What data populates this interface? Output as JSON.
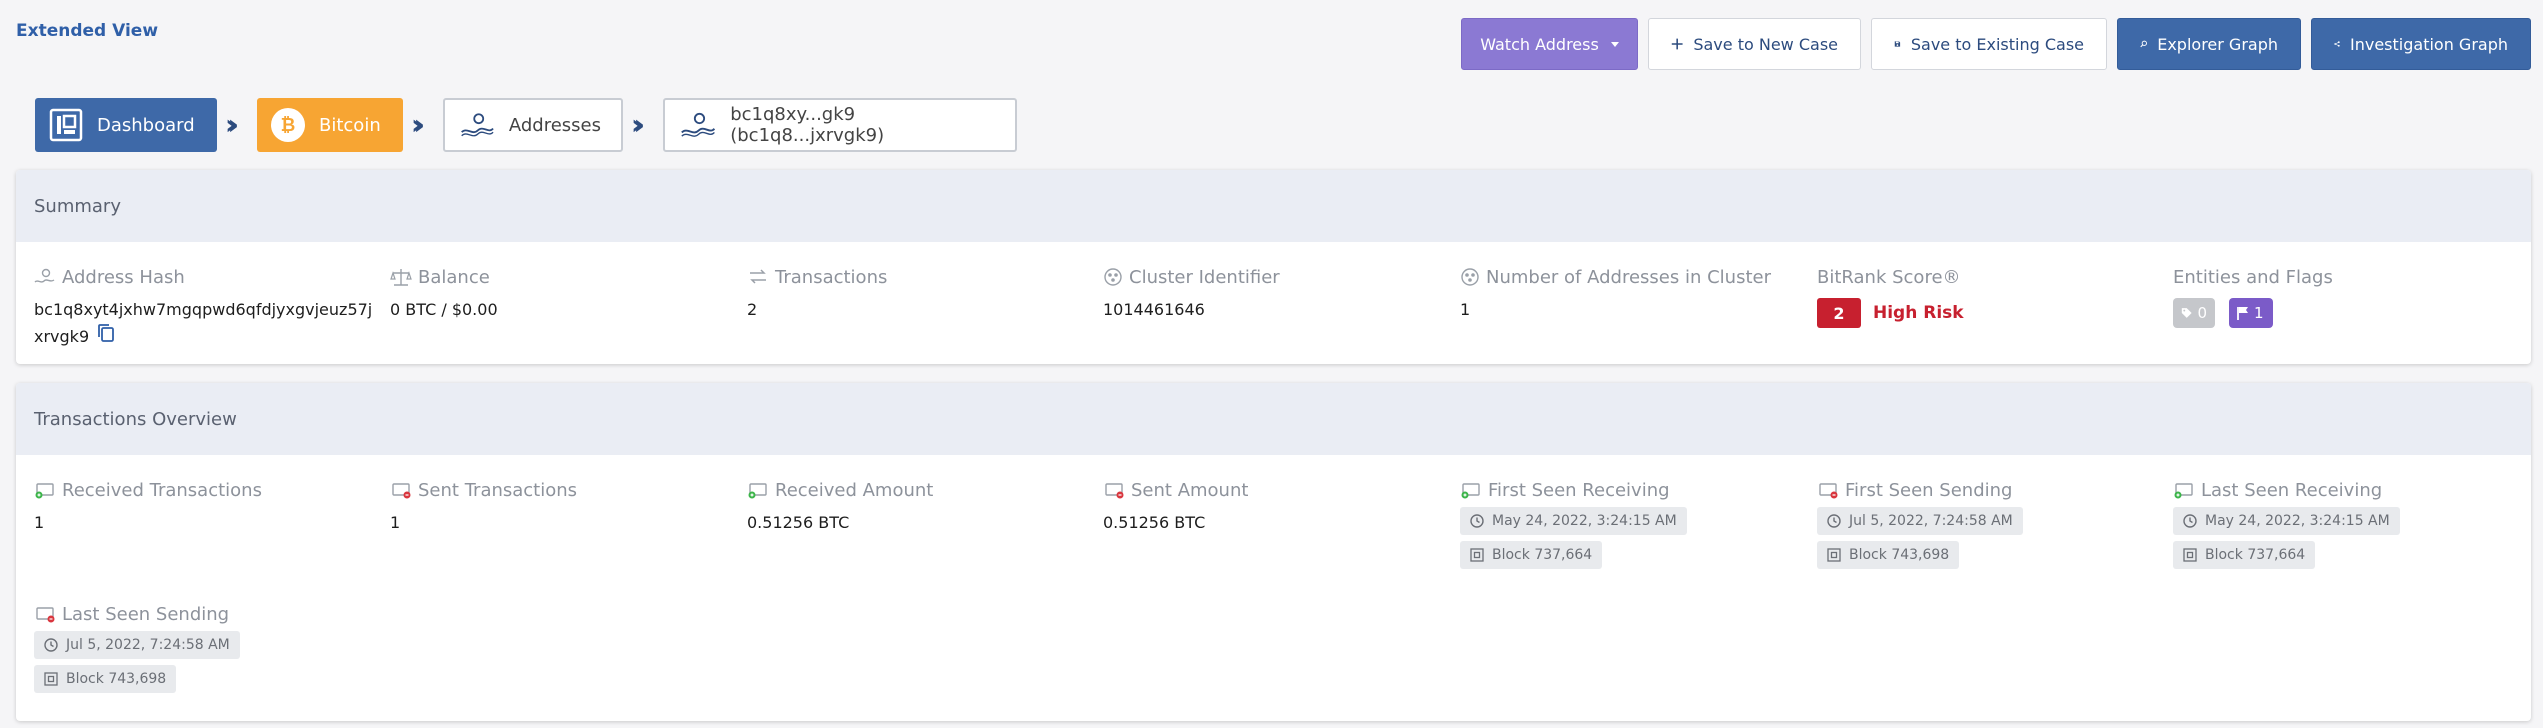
{
  "header": {
    "extended_view": "Extended View",
    "buttons": {
      "watch": "Watch Address",
      "save_new": "Save to New Case",
      "save_existing": "Save to Existing Case",
      "explorer": "Explorer Graph",
      "investigation": "Investigation Graph"
    }
  },
  "breadcrumb": {
    "dashboard": "Dashboard",
    "bitcoin": "Bitcoin",
    "addresses": "Addresses",
    "address": "bc1q8xy...gk9 (bc1q8...jxrvgk9)"
  },
  "summary": {
    "title": "Summary",
    "address_hash_label": "Address Hash",
    "address_hash_line1": "bc1q8xyt4jxhw7mgqpwd6qfdjyxgvjeuz57j",
    "address_hash_line2": "xrvgk9",
    "balance_label": "Balance",
    "balance_value": "0 BTC / $0.00",
    "transactions_label": "Transactions",
    "transactions_value": "2",
    "cluster_label": "Cluster Identifier",
    "cluster_value": "1014461646",
    "num_addresses_label": "Number of Addresses in Cluster",
    "num_addresses_value": "1",
    "bitrank_label": "BitRank Score®",
    "bitrank_score": "2",
    "bitrank_risk": "High Risk",
    "entities_label": "Entities and Flags",
    "tags_count": "0",
    "flags_count": "1"
  },
  "overview": {
    "title": "Transactions Overview",
    "received_tx_label": "Received Transactions",
    "received_tx_value": "1",
    "sent_tx_label": "Sent Transactions",
    "sent_tx_value": "1",
    "received_amount_label": "Received Amount",
    "received_amount_value": "0.51256 BTC",
    "sent_amount_label": "Sent Amount",
    "sent_amount_value": "0.51256 BTC",
    "first_receiving_label": "First Seen Receiving",
    "first_receiving_time": "May 24, 2022, 3:24:15 AM",
    "first_receiving_block": "Block 737,664",
    "first_sending_label": "First Seen Sending",
    "first_sending_time": "Jul 5, 2022, 7:24:58 AM",
    "first_sending_block": "Block 743,698",
    "last_receiving_label": "Last Seen Receiving",
    "last_receiving_time": "May 24, 2022, 3:24:15 AM",
    "last_receiving_block": "Block 737,664",
    "last_sending_label": "Last Seen Sending",
    "last_sending_time": "Jul 5, 2022, 7:24:58 AM",
    "last_sending_block": "Block 743,698"
  },
  "colors": {
    "primary_blue": "#3e69a8",
    "purple": "#8b79d3",
    "bitcoin_orange": "#f7a533",
    "risk_red": "#c7202f",
    "flag_purple": "#7b5bc8"
  },
  "icons": {
    "address": "person-wave-icon",
    "balance": "scale-icon",
    "transactions": "transfer-icon",
    "cluster": "cluster-icon",
    "received": "wallet-in-icon",
    "sent": "wallet-out-icon",
    "clock": "clock-icon",
    "block": "block-icon",
    "tag": "tag-icon",
    "flag": "flag-icon"
  }
}
